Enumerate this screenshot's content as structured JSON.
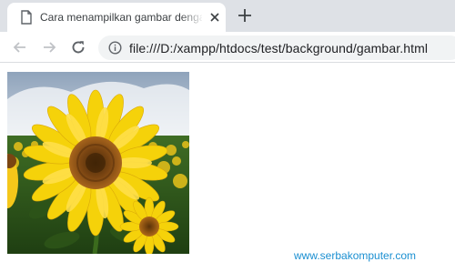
{
  "browser": {
    "tab": {
      "title": "Cara menampilkan gambar dengan CSS"
    },
    "address_bar": {
      "url": "file:///D:/xampp/htdocs/test/background/gambar.html"
    }
  },
  "page": {
    "image": {
      "subject": "sunflower"
    },
    "footer_link": "www.serbakomputer.com"
  },
  "icons": {
    "favicon": "page-icon",
    "close": "close-icon",
    "new_tab": "plus-icon",
    "back": "back-arrow-icon",
    "forward": "forward-arrow-icon",
    "reload": "reload-icon",
    "info": "info-icon"
  },
  "colors": {
    "tabstrip": "#dee1e6",
    "omnibox": "#f1f3f4",
    "link": "#1a8fd1",
    "petal": "#f5d20a",
    "disk": "#8a5216"
  }
}
